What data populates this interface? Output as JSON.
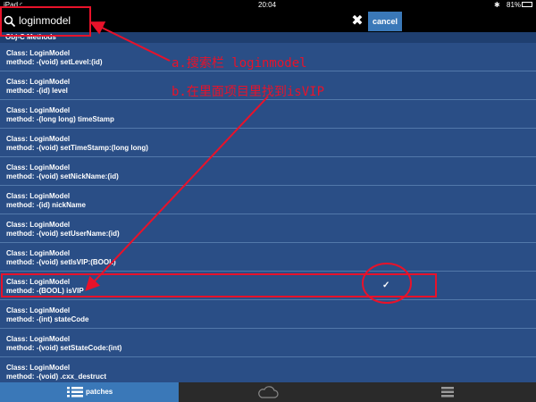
{
  "status": {
    "device": "iPad",
    "time": "20:04",
    "battery": "81%"
  },
  "search": {
    "query": "loginmodel",
    "cancel_label": "cancel"
  },
  "section": {
    "title": "Obj-C Methods"
  },
  "rows": [
    {
      "cls": "Class: LoginModel",
      "method": "method: -(void) setLevel:(id)"
    },
    {
      "cls": "Class: LoginModel",
      "method": "method: -(id) level"
    },
    {
      "cls": "Class: LoginModel",
      "method": "method: -(long long) timeStamp"
    },
    {
      "cls": "Class: LoginModel",
      "method": "method: -(void) setTimeStamp:(long long)"
    },
    {
      "cls": "Class: LoginModel",
      "method": "method: -(void) setNickName:(id)"
    },
    {
      "cls": "Class: LoginModel",
      "method": "method: -(id) nickName"
    },
    {
      "cls": "Class: LoginModel",
      "method": "method: -(void) setUserName:(id)"
    },
    {
      "cls": "Class: LoginModel",
      "method": "method: -(void) setIsVIP:(BOOL)"
    },
    {
      "cls": "Class: LoginModel",
      "method": "method: -(BOOL) isVIP",
      "checked": true,
      "check": "✓"
    },
    {
      "cls": "Class: LoginModel",
      "method": "method: -(int) stateCode"
    },
    {
      "cls": "Class: LoginModel",
      "method": "method: -(void) setStateCode:(int)"
    },
    {
      "cls": "Class: LoginModel",
      "method": "method: -(void) .cxx_destruct"
    }
  ],
  "tabs": {
    "patches": "patches"
  },
  "annotations": {
    "a": "a.搜索栏 loginmodel",
    "b": "b.在里面项目里找到isVIP"
  },
  "colors": {
    "accent": "#3a78b8",
    "annotation": "#e8122a"
  }
}
